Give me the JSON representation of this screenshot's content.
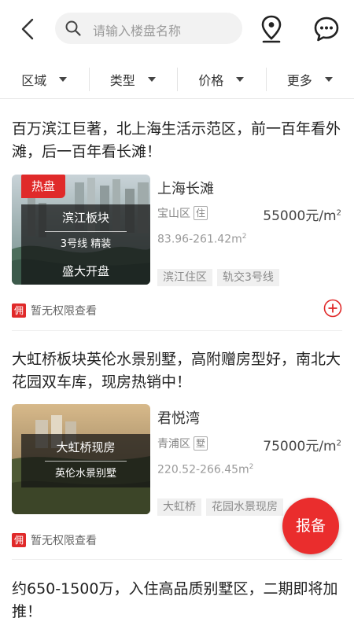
{
  "search": {
    "placeholder": "请输入楼盘名称"
  },
  "filters": [
    {
      "label": "区域"
    },
    {
      "label": "类型"
    },
    {
      "label": "价格"
    },
    {
      "label": "更多"
    }
  ],
  "listings": [
    {
      "title": "百万滨江巨著，北上海生活示范区，前一百年看外滩，后一百年看长滩！",
      "badge": "热盘",
      "overlay_lines": [
        "滨江板块",
        "3号线  精装",
        "盛大开盘"
      ],
      "name": "上海长滩",
      "district": "宝山区",
      "district_tag": "住",
      "price": "55000元/m",
      "price_unit_sup": "2",
      "area": "83.96-261.42m",
      "area_sup": "2",
      "tags": [
        "滨江住区",
        "轨交3号线"
      ],
      "permission_badge": "佣",
      "permission_text": "暂无权限查看"
    },
    {
      "title": "大虹桥板块英伦水景别墅，高附赠房型好，南北大花园双车库，现房热销中！",
      "overlay_lines": [
        "大虹桥现房",
        "英伦水景别墅"
      ],
      "name": "君悦湾",
      "district": "青浦区",
      "district_tag": "墅",
      "price": "75000元/m",
      "price_unit_sup": "2",
      "area": "220.52-266.45m",
      "area_sup": "2",
      "tags": [
        "大虹桥",
        "花园水景现房"
      ],
      "permission_badge": "佣",
      "permission_text": "暂无权限查看"
    },
    {
      "title": "约650-1500万，入住高品质别墅区，二期即将加推！"
    }
  ],
  "fab": {
    "label": "报备"
  },
  "colors": {
    "accent": "#e02a2a",
    "chip_bg": "#f0f0f0"
  },
  "icons": [
    "back-arrow-icon",
    "search-icon",
    "location-pin-icon",
    "message-icon",
    "plus-circle-icon"
  ]
}
